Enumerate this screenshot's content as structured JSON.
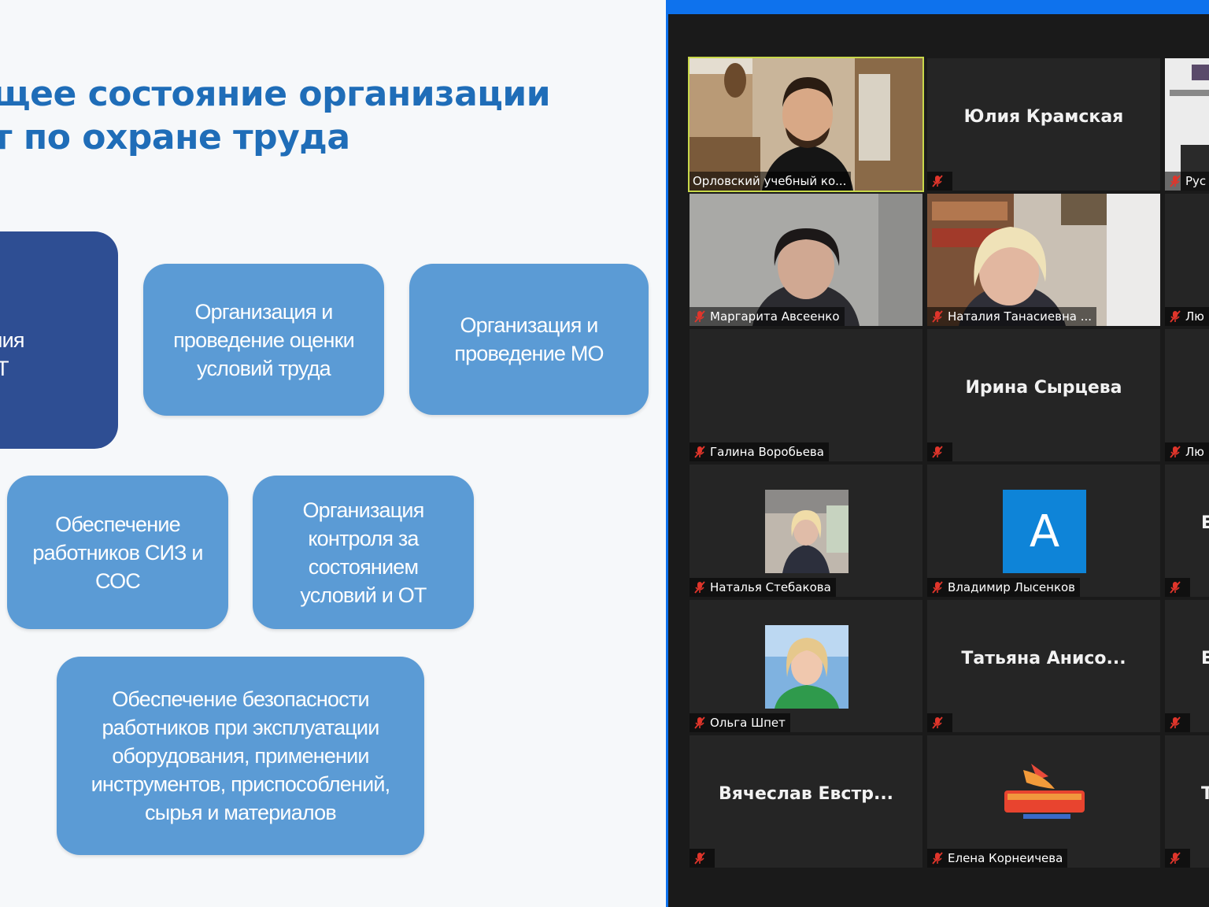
{
  "slide": {
    "title_line1": "щее состояние организации",
    "title_line2": "т по охране труда",
    "boxes": {
      "training": "ция и\nобучения\nв по ОТ",
      "assessment": "Организация и\nпроведение оценки\nусловий труда",
      "medical": "Организация и\nпроведение МО",
      "ppe": "Обеспечение\nработников СИЗ и\nСОС",
      "control": "Организация\nконтроля за\nсостоянием\nусловий и ОТ",
      "equipment": "Обеспечение безопасности\nработников при эксплуатации\nоборудования, применении\nинструментов, приспособлений,\nсырья и материалов"
    }
  },
  "zoom": {
    "colors": {
      "accent": "#0e72ed",
      "active_speaker": "#c8d84a",
      "muted_icon": "#e0352b",
      "avatar_bg": "#0e84d8"
    },
    "participants": [
      {
        "label": "Орловский учебный ко...",
        "name": "",
        "muted": false,
        "kind": "video-man",
        "active": true
      },
      {
        "label": "",
        "name": "Юлия Крамская",
        "muted": true,
        "kind": "name"
      },
      {
        "label": "Рус",
        "name": "",
        "muted": true,
        "kind": "video-poster"
      },
      {
        "label": "Маргарита Авсеенко",
        "name": "",
        "muted": true,
        "kind": "video-woman1"
      },
      {
        "label": "Наталия Танасиевна ...",
        "name": "",
        "muted": true,
        "kind": "video-woman2"
      },
      {
        "label": "Лю",
        "name": "",
        "muted": true,
        "kind": "blank"
      },
      {
        "label": "Галина Воробьева",
        "name": "",
        "muted": true,
        "kind": "blank"
      },
      {
        "label": "",
        "name": "Ирина Сырцева",
        "muted": true,
        "kind": "name"
      },
      {
        "label": "Лю",
        "name": "",
        "muted": true,
        "kind": "blank"
      },
      {
        "label": "Наталья Стебакова",
        "name": "",
        "muted": true,
        "kind": "avatar-photo1"
      },
      {
        "label": "Владимир Лысенков",
        "name": "",
        "muted": true,
        "kind": "avatar-letter",
        "letter": "A"
      },
      {
        "label": "",
        "name": "Е",
        "muted": true,
        "kind": "name-partial"
      },
      {
        "label": "Ольга Шпет",
        "name": "",
        "muted": true,
        "kind": "avatar-photo2"
      },
      {
        "label": "",
        "name": "Татьяна  Анисо...",
        "muted": true,
        "kind": "name"
      },
      {
        "label": "",
        "name": "Е",
        "muted": true,
        "kind": "name-partial"
      },
      {
        "label": "",
        "name": "Вячеслав  Евстр...",
        "muted": true,
        "kind": "name"
      },
      {
        "label": "Елена Корнеичева",
        "name": "",
        "muted": true,
        "kind": "logo"
      },
      {
        "label": "",
        "name": "Т",
        "muted": true,
        "kind": "name-partial"
      }
    ]
  }
}
